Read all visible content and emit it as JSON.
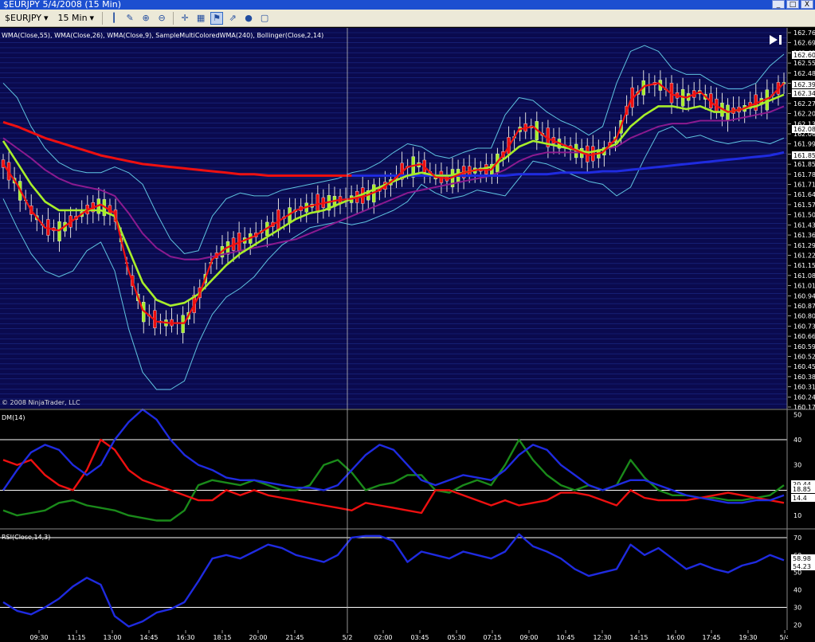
{
  "window": {
    "title": "$EURJPY   5/4/2008 (15 Min)",
    "buttons": [
      "_",
      "□",
      "X"
    ]
  },
  "toolbar": {
    "instrument": "$EURJPY",
    "interval": "15 Min",
    "icons": [
      "bar-type-icon",
      "draw-pen-icon",
      "zoom-in-icon",
      "zoom-out-icon",
      "crosshair-icon",
      "properties-icon",
      "indicators-icon",
      "strategies-icon",
      "record-icon",
      "ninjascript-icon"
    ]
  },
  "colors": {
    "price_bg": "#0a0a4e",
    "grid": "#1c2a8a",
    "bollinger": "#5fc3df",
    "wma55": "#8b1a8f",
    "wma26": "#a8ee2a",
    "wma9": "#ee1010",
    "wma240": "#ee1010",
    "wma240_alt": "#1f2be0",
    "plus_di": "#1a8a1a",
    "minus_di": "#ee1010",
    "adx": "#1f2be0",
    "rsi": "#1f2be0",
    "candle_up": "#a8ee2a",
    "candle_down": "#ee1010"
  },
  "price_panel": {
    "indicator_label": "WMA(Close,55), WMA(Close,26), WMA(Close,9), SampleMultiColoredWMA(240), Bollinger(Close,2,14)",
    "copyright": "© 2008 NinjaTrader, LLC",
    "axis_labels": [
      "162.76",
      "162.69",
      "162.62",
      "162.55",
      "162.48",
      "162.41",
      "162.34",
      "162.27",
      "162.20",
      "162.13",
      "162.06",
      "161.99",
      "161.92",
      "161.85",
      "161.78",
      "161.71",
      "161.64",
      "161.57",
      "161.50",
      "161.43",
      "161.36",
      "161.29",
      "161.22",
      "161.15",
      "161.08",
      "161.01",
      "160.94",
      "160.87",
      "160.80",
      "160.73",
      "160.66",
      "160.59",
      "160.52",
      "160.45",
      "160.38",
      "160.31",
      "160.24",
      "160.17"
    ],
    "axis_boxes": [
      "162.60",
      "162.39",
      "162.34",
      "162.08",
      "161.85"
    ],
    "last_price": "162.34"
  },
  "dm_panel": {
    "label": "DM(14)",
    "axis_labels": [
      "50",
      "40",
      "30",
      "20",
      "10"
    ],
    "axis_boxes": [
      "20.44",
      "18.85",
      "14.4"
    ]
  },
  "rsi_panel": {
    "label": "RSI(Close,14,3)",
    "axis_labels": [
      "70",
      "60",
      "50",
      "40",
      "30",
      "20"
    ],
    "axis_boxes": [
      "58.98",
      "54.23"
    ]
  },
  "time_axis": [
    "09:30",
    "11:15",
    "13:00",
    "14:45",
    "16:30",
    "18:15",
    "20:00",
    "21:45",
    "5/2",
    "02:00",
    "03:45",
    "05:30",
    "07:15",
    "09:00",
    "10:45",
    "12:30",
    "14:15",
    "16:00",
    "17:45",
    "19:30",
    "5/4"
  ],
  "chart_data": [
    {
      "type": "line",
      "title": "",
      "price_range": [
        160.17,
        162.76
      ],
      "series": [
        {
          "name": "WMA(Close,9)",
          "values": [
            161.84,
            161.7,
            161.52,
            161.4,
            161.38,
            161.45,
            161.52,
            161.56,
            161.5,
            161.1,
            160.83,
            160.75,
            160.74,
            160.74,
            160.92,
            161.18,
            161.26,
            161.3,
            161.34,
            161.4,
            161.46,
            161.52,
            161.55,
            161.57,
            161.59,
            161.6,
            161.62,
            161.66,
            161.73,
            161.82,
            161.84,
            161.75,
            161.74,
            161.78,
            161.8,
            161.8,
            161.92,
            162.08,
            162.1,
            162.02,
            161.98,
            161.94,
            161.9,
            161.92,
            162.02,
            162.28,
            162.38,
            162.4,
            162.32,
            162.3,
            162.34,
            162.25,
            162.2,
            162.22,
            162.26,
            162.3,
            162.4
          ]
        },
        {
          "name": "WMA(Close,26)",
          "values": [
            162.0,
            161.85,
            161.7,
            161.58,
            161.52,
            161.52,
            161.52,
            161.52,
            161.48,
            161.25,
            161.02,
            160.9,
            160.86,
            160.88,
            160.94,
            161.04,
            161.14,
            161.22,
            161.28,
            161.34,
            161.4,
            161.46,
            161.5,
            161.52,
            161.56,
            161.6,
            161.64,
            161.68,
            161.72,
            161.76,
            161.78,
            161.76,
            161.76,
            161.78,
            161.8,
            161.82,
            161.88,
            161.96,
            162.0,
            161.98,
            161.96,
            161.94,
            161.92,
            161.94,
            161.98,
            162.1,
            162.18,
            162.24,
            162.24,
            162.22,
            162.24,
            162.2,
            162.2,
            162.22,
            162.24,
            162.28,
            162.32
          ]
        },
        {
          "name": "WMA(Close,55)",
          "values": [
            162.02,
            161.95,
            161.88,
            161.8,
            161.74,
            161.7,
            161.68,
            161.66,
            161.62,
            161.5,
            161.36,
            161.26,
            161.2,
            161.18,
            161.18,
            161.2,
            161.22,
            161.24,
            161.26,
            161.28,
            161.3,
            161.32,
            161.36,
            161.4,
            161.44,
            161.48,
            161.52,
            161.56,
            161.6,
            161.64,
            161.66,
            161.68,
            161.7,
            161.72,
            161.74,
            161.76,
            161.8,
            161.86,
            161.9,
            161.92,
            161.92,
            161.92,
            161.92,
            161.94,
            161.96,
            162.02,
            162.06,
            162.1,
            162.12,
            162.12,
            162.14,
            162.14,
            162.14,
            162.16,
            162.18,
            162.2,
            162.24
          ]
        },
        {
          "name": "SampleMultiColoredWMA(240)",
          "values": [
            162.13,
            162.1,
            162.06,
            162.02,
            161.99,
            161.96,
            161.93,
            161.9,
            161.88,
            161.86,
            161.84,
            161.83,
            161.82,
            161.81,
            161.8,
            161.79,
            161.78,
            161.77,
            161.77,
            161.76,
            161.76,
            161.76,
            161.76,
            161.76,
            161.76,
            161.76,
            161.76,
            161.76,
            161.76,
            161.76,
            161.76,
            161.76,
            161.76,
            161.76,
            161.76,
            161.76,
            161.76,
            161.77,
            161.77,
            161.77,
            161.78,
            161.78,
            161.78,
            161.79,
            161.79,
            161.8,
            161.81,
            161.82,
            161.83,
            161.84,
            161.85,
            161.86,
            161.87,
            161.88,
            161.89,
            161.9,
            161.92
          ]
        },
        {
          "name": "Bollinger Upper",
          "values": [
            162.4,
            162.3,
            162.1,
            161.95,
            161.85,
            161.8,
            161.78,
            161.78,
            161.82,
            161.78,
            161.7,
            161.5,
            161.32,
            161.22,
            161.24,
            161.48,
            161.6,
            161.64,
            161.62,
            161.62,
            161.66,
            161.68,
            161.7,
            161.72,
            161.74,
            161.78,
            161.8,
            161.85,
            161.92,
            161.98,
            161.96,
            161.9,
            161.88,
            161.92,
            161.95,
            161.95,
            162.18,
            162.3,
            162.28,
            162.2,
            162.14,
            162.1,
            162.04,
            162.1,
            162.4,
            162.62,
            162.66,
            162.62,
            162.5,
            162.46,
            162.46,
            162.4,
            162.36,
            162.36,
            162.4,
            162.52,
            162.6
          ]
        },
        {
          "name": "Bollinger Lower",
          "values": [
            161.6,
            161.4,
            161.22,
            161.1,
            161.06,
            161.1,
            161.24,
            161.3,
            161.1,
            160.7,
            160.4,
            160.28,
            160.28,
            160.34,
            160.6,
            160.8,
            160.92,
            160.98,
            161.06,
            161.18,
            161.28,
            161.34,
            161.4,
            161.42,
            161.44,
            161.42,
            161.44,
            161.48,
            161.52,
            161.58,
            161.7,
            161.64,
            161.6,
            161.62,
            161.66,
            161.64,
            161.62,
            161.74,
            161.86,
            161.84,
            161.8,
            161.76,
            161.72,
            161.7,
            161.62,
            161.68,
            161.88,
            162.06,
            162.1,
            162.02,
            162.04,
            162.0,
            161.98,
            162.0,
            162.0,
            161.98,
            162.02
          ]
        }
      ]
    },
    {
      "type": "line",
      "title": "",
      "y_range": [
        5,
        52
      ],
      "series": [
        {
          "name": "ADX",
          "values": [
            20,
            28,
            35,
            38,
            36,
            30,
            26,
            30,
            40,
            47,
            52,
            48,
            40,
            34,
            30,
            28,
            25,
            24,
            24,
            23,
            22,
            21,
            21,
            20,
            22,
            28,
            34,
            38,
            36,
            30,
            24,
            22,
            24,
            26,
            25,
            24,
            28,
            34,
            38,
            36,
            30,
            26,
            22,
            20,
            22,
            24,
            24,
            22,
            20,
            18,
            17,
            16,
            15,
            15,
            16,
            16,
            18
          ]
        },
        {
          "name": "+DI",
          "values": [
            12,
            10,
            11,
            12,
            15,
            16,
            14,
            13,
            12,
            10,
            9,
            8,
            8,
            12,
            22,
            24,
            23,
            22,
            24,
            22,
            20,
            20,
            22,
            30,
            32,
            27,
            20,
            22,
            23,
            26,
            26,
            20,
            19,
            22,
            24,
            22,
            30,
            40,
            32,
            26,
            22,
            20,
            22,
            20,
            22,
            32,
            25,
            20,
            18,
            18,
            17,
            17,
            16,
            16,
            17,
            18,
            22
          ]
        },
        {
          "name": "-DI",
          "values": [
            32,
            30,
            32,
            26,
            22,
            20,
            28,
            40,
            36,
            28,
            24,
            22,
            20,
            18,
            16,
            16,
            20,
            18,
            20,
            18,
            17,
            16,
            15,
            14,
            13,
            12,
            15,
            14,
            13,
            12,
            11,
            20,
            20,
            18,
            16,
            14,
            16,
            14,
            15,
            16,
            19,
            19,
            18,
            16,
            14,
            20,
            17,
            16,
            16,
            16,
            17,
            18,
            19,
            18,
            17,
            16,
            15
          ]
        }
      ]
    },
    {
      "type": "line",
      "title": "",
      "y_range": [
        17,
        75
      ],
      "series": [
        {
          "name": "RSI",
          "values": [
            33,
            28,
            26,
            30,
            35,
            42,
            47,
            43,
            25,
            19,
            22,
            27,
            29,
            33,
            45,
            58,
            60,
            58,
            62,
            66,
            64,
            60,
            58,
            56,
            60,
            70,
            71,
            71,
            68,
            56,
            62,
            60,
            58,
            62,
            60,
            58,
            62,
            72,
            65,
            62,
            58,
            52,
            48,
            50,
            52,
            66,
            60,
            64,
            58,
            52,
            55,
            52,
            50,
            54,
            56,
            60,
            57
          ]
        }
      ]
    }
  ]
}
